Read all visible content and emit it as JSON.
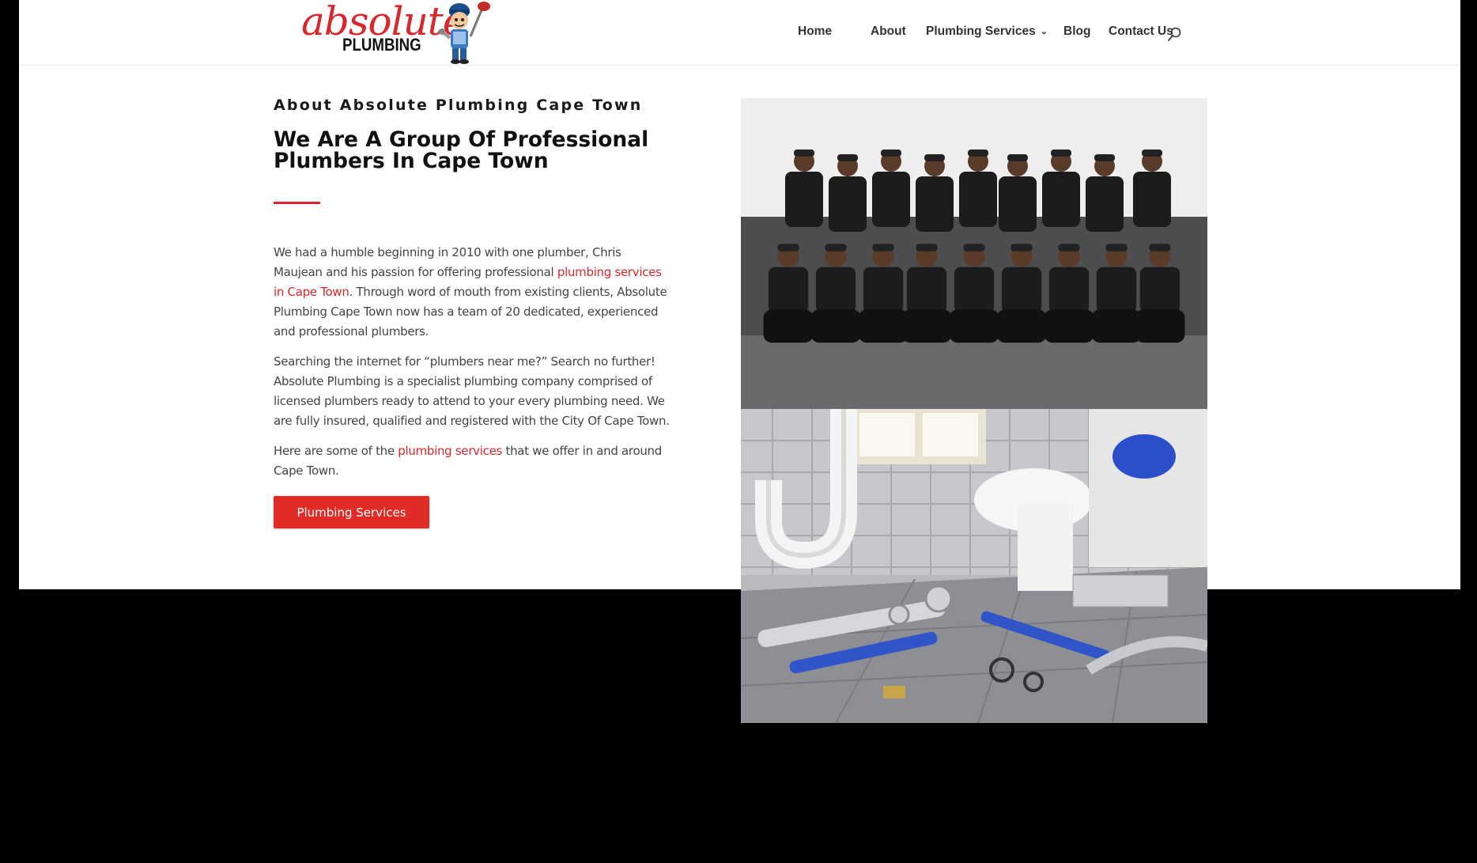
{
  "brand": {
    "logo_word": "absolute",
    "logo_sub": "PLUMBING",
    "logo_alt": "Absolute Plumbing logo",
    "accent_color": "#d9272e"
  },
  "nav": {
    "items": [
      {
        "label": "Home"
      },
      {
        "label": "About"
      },
      {
        "label": "Plumbing Services",
        "has_dropdown": true
      },
      {
        "label": "Blog"
      },
      {
        "label": "Contact Us"
      }
    ],
    "search_icon": "search-icon"
  },
  "about": {
    "eyebrow": "About Absolute Plumbing Cape Town",
    "headline": "We Are A Group Of Professional Plumbers In Cape Town",
    "p1_before": "We had a humble beginning in 2010 with one plumber, Chris Maujean and his passion for offering professional ",
    "p1_link": "plumbing services in Cape Town",
    "p1_after": ". Through word of mouth from existing clients, Absolute Plumbing Cape Town now has a team of 20 dedicated, experienced and professional plumbers.",
    "p2": "Searching the internet for “plumbers near me?” Search no further! Absolute Plumbing is a specialist plumbing company comprised of licensed plumbers ready to attend to your every plumbing need. We are fully insured, qualified and registered with the City Of Cape Town.",
    "p3_before": "Here are some of the ",
    "p3_link": "plumbing services",
    "p3_after": " that we offer in and around Cape Town.",
    "cta_label": "Plumbing Services"
  },
  "images": {
    "team_photo": "team-photo",
    "tools_photo": "plumbing-tools-photo"
  }
}
